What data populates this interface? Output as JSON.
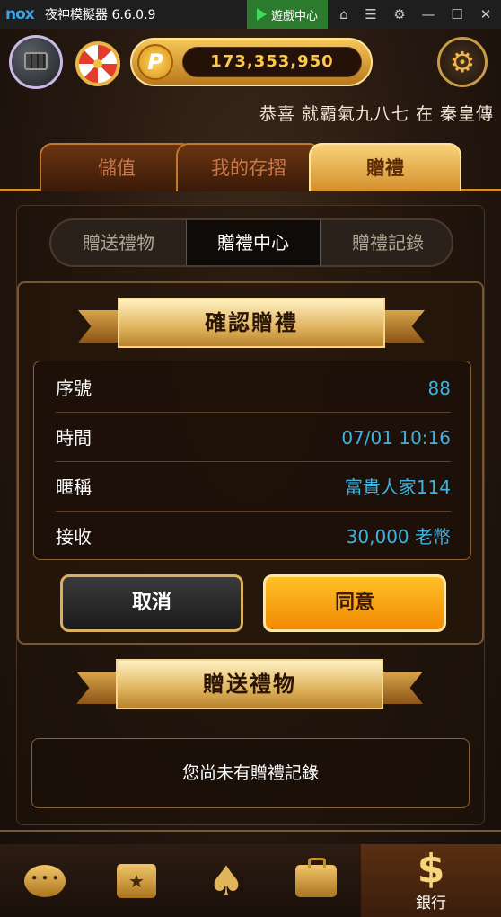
{
  "window": {
    "logo": "nox",
    "title": "夜神模擬器 6.6.0.9",
    "game_center": "遊戲中心"
  },
  "header": {
    "coins": "173,353,950",
    "coin_symbol": "P",
    "marquee": "恭喜 就霸氣九八七 在 秦皇傳"
  },
  "tabs": [
    {
      "label": "儲值",
      "active": false
    },
    {
      "label": "我的存摺",
      "active": false
    },
    {
      "label": "贈禮",
      "active": true
    }
  ],
  "subtabs": [
    {
      "label": "贈送禮物",
      "active": false
    },
    {
      "label": "贈禮中心",
      "active": true
    },
    {
      "label": "贈禮記錄",
      "active": false
    }
  ],
  "confirm": {
    "title": "確認贈禮",
    "rows": [
      {
        "label": "序號",
        "value": "88"
      },
      {
        "label": "時間",
        "value": "07/01 10:16"
      },
      {
        "label": "暱稱",
        "value": "富貴人家114"
      },
      {
        "label": "接收",
        "value": "30,000 老幣"
      }
    ],
    "cancel_label": "取消",
    "ok_label": "同意"
  },
  "gifts": {
    "title": "贈送禮物",
    "empty_text": "您尚未有贈禮記錄"
  },
  "nav": {
    "items": [
      {
        "icon": "chat-icon"
      },
      {
        "icon": "calendar-icon"
      },
      {
        "icon": "spade-icon"
      },
      {
        "icon": "briefcase-icon"
      },
      {
        "icon": "dollar-icon",
        "label": "銀行",
        "active": true
      }
    ]
  },
  "colors": {
    "accent_gold": "#d38f2b",
    "value_blue": "#3fb3e0",
    "ok_orange": "#f28a00"
  }
}
